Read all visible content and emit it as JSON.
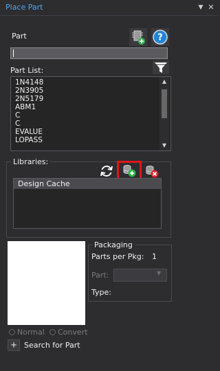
{
  "window": {
    "title": "Place Part",
    "dropdown_glyph": "▼",
    "close_glyph": "✕"
  },
  "part": {
    "label": "Part",
    "value": ""
  },
  "part_list": {
    "label": "Part List:",
    "items": [
      "1N4148",
      "2N3905",
      "2N5179",
      "ABM1",
      "C",
      "C",
      "EVALUE",
      "LOPASS"
    ]
  },
  "libraries": {
    "label": "Libraries:",
    "items": [
      "Design Cache"
    ]
  },
  "packaging": {
    "label": "Packaging",
    "parts_per_pkg_label": "Parts per Pkg:",
    "parts_per_pkg_value": "1",
    "part_label": "Part:",
    "type_label": "Type:"
  },
  "view_options": {
    "normal_label": "Normal",
    "convert_label": "Convert"
  },
  "search": {
    "expand_glyph": "+",
    "label": "Search for Part"
  },
  "icons": {
    "help": "help-icon",
    "add_part": "add-part-icon",
    "filter": "filter-icon",
    "refresh": "refresh-icon",
    "add_library": "add-library-icon",
    "remove_library": "remove-library-icon"
  },
  "colors": {
    "title": "#4ea6ea",
    "highlight": "#e0161c",
    "add": "#2fb44a",
    "remove": "#d81f26",
    "help": "#1e86d8"
  }
}
